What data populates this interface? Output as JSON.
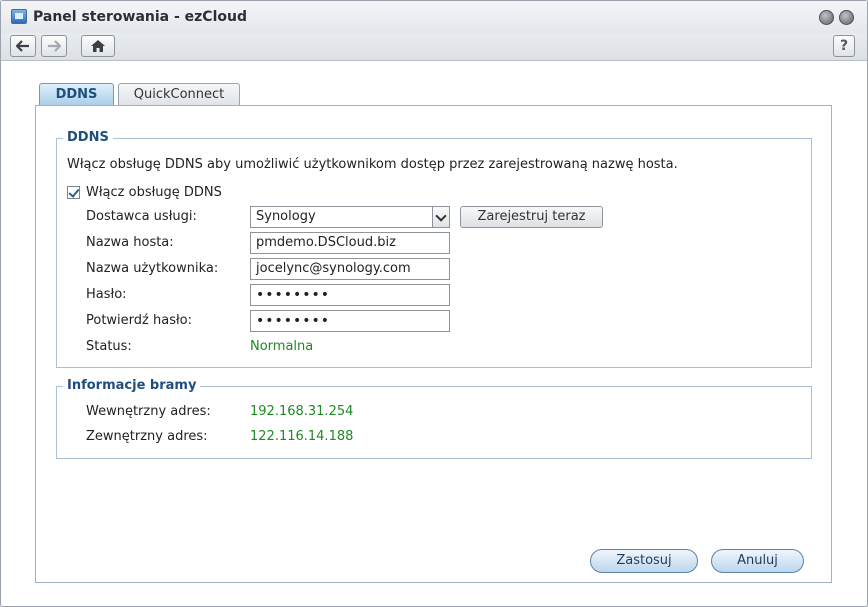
{
  "window": {
    "title": "Panel sterowania - ezCloud",
    "help_label": "?"
  },
  "toolbar": {
    "back_icon": "arrow-left-icon",
    "forward_icon": "arrow-right-icon",
    "home_icon": "home-icon"
  },
  "tabs": [
    {
      "label": "DDNS",
      "active": true
    },
    {
      "label": "QuickConnect",
      "active": false
    }
  ],
  "ddns": {
    "legend": "DDNS",
    "description": "Włącz obsługę DDNS aby umożliwić użytkownikom dostęp przez zarejestrowaną nazwę hosta.",
    "enable_label": "Włącz obsługę DDNS",
    "enabled": true,
    "provider_label": "Dostawca usługi:",
    "provider_value": "Synology",
    "register_button": "Zarejestruj teraz",
    "hostname_label": "Nazwa hosta:",
    "hostname_value": "pmdemo.DSCloud.biz",
    "username_label": "Nazwa użytkownika:",
    "username_value": "jocelync@synology.com",
    "password_label": "Hasło:",
    "password_value": "••••••••",
    "confirm_label": "Potwierdź hasło:",
    "confirm_value": "••••••••",
    "status_label": "Status:",
    "status_value": "Normalna"
  },
  "gateway": {
    "legend": "Informacje bramy",
    "internal_label": "Wewnętrzny adres:",
    "internal_value": "192.168.31.254",
    "external_label": "Zewnętrzny adres:",
    "external_value": "122.116.14.188"
  },
  "actions": {
    "apply": "Zastosuj",
    "cancel": "Anuluj"
  },
  "colors": {
    "status_green": "#1e8a22",
    "accent_blue": "#1f4f7d"
  }
}
